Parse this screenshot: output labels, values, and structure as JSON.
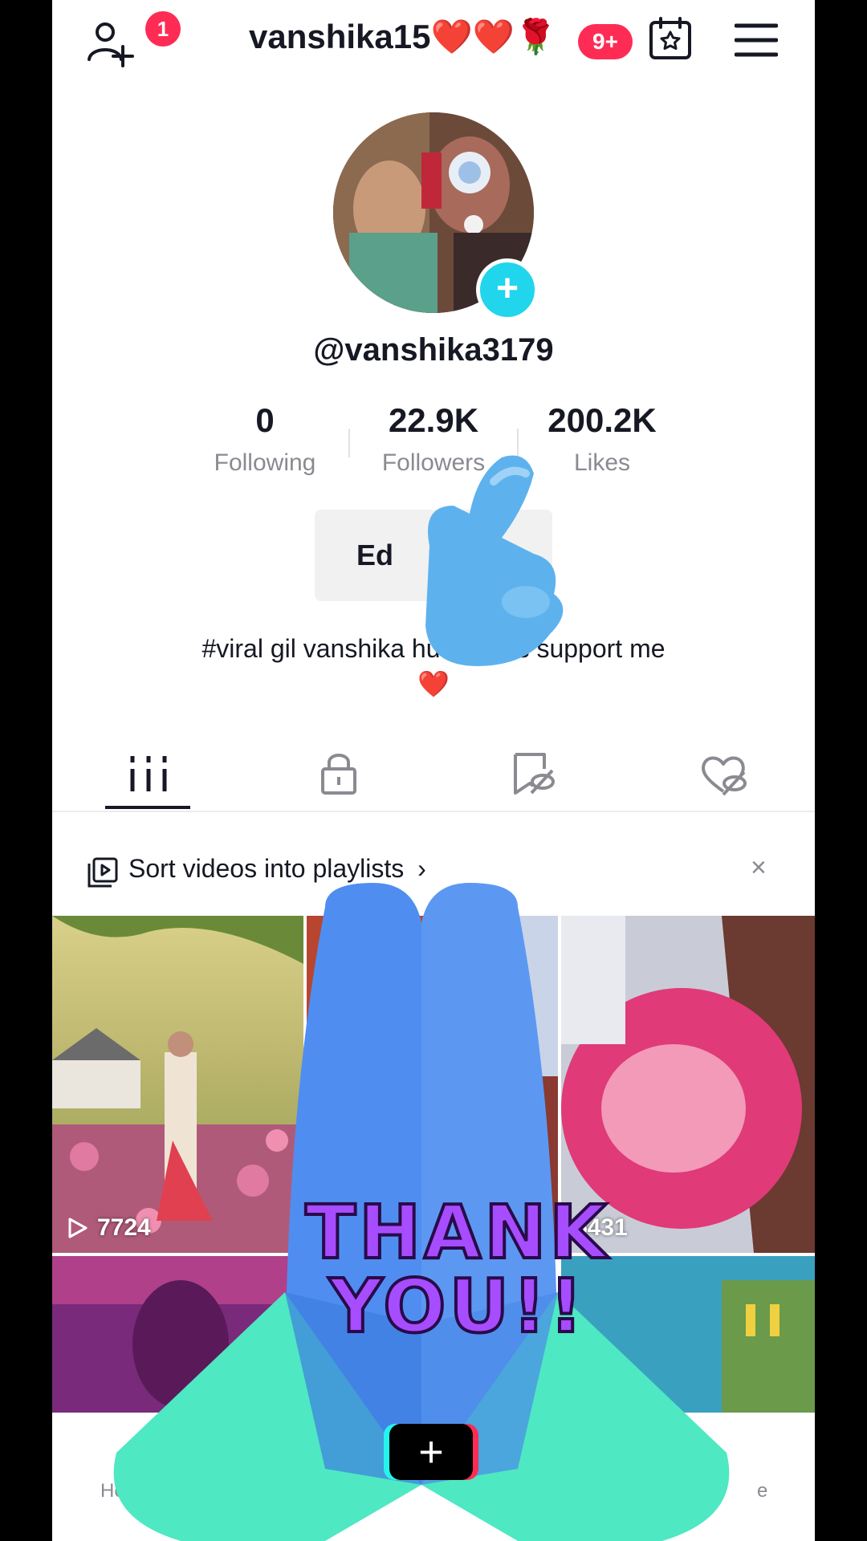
{
  "header": {
    "friend_badge": "1",
    "username": "vanshika15❤️❤️🌹",
    "notif_badge": "9+"
  },
  "profile": {
    "handle": "@vanshika3179",
    "stats": [
      {
        "value": "0",
        "label": "Following"
      },
      {
        "value": "22.9K",
        "label": "Followers"
      },
      {
        "value": "200.2K",
        "label": "Likes"
      }
    ],
    "edit_label": "Ed",
    "bio_line1": "#viral gil vanshika hu friend's support me",
    "bio_line2": "❤️"
  },
  "tabs": [
    {
      "name": "videos-grid-icon"
    },
    {
      "name": "private-lock-icon"
    },
    {
      "name": "favorites-icon"
    },
    {
      "name": "liked-icon"
    }
  ],
  "playlist": {
    "label": "Sort videos into playlists",
    "chevron": "›",
    "close": "×"
  },
  "videos": [
    {
      "views": "7724"
    },
    {
      "views": ""
    },
    {
      "views": "5431"
    }
  ],
  "bottom_nav": {
    "home_label": "Ho",
    "create_label": "+",
    "profile_label": "e"
  },
  "overlay": {
    "thank_line1": "THANK",
    "thank_line2": "YOU!!"
  },
  "colors": {
    "accent": "#fe2c55",
    "cyan": "#20d5ec",
    "emoji_blue": "#4f8ef0",
    "emoji_teal": "#4ee8c2",
    "thank_purple": "#a64dff"
  }
}
